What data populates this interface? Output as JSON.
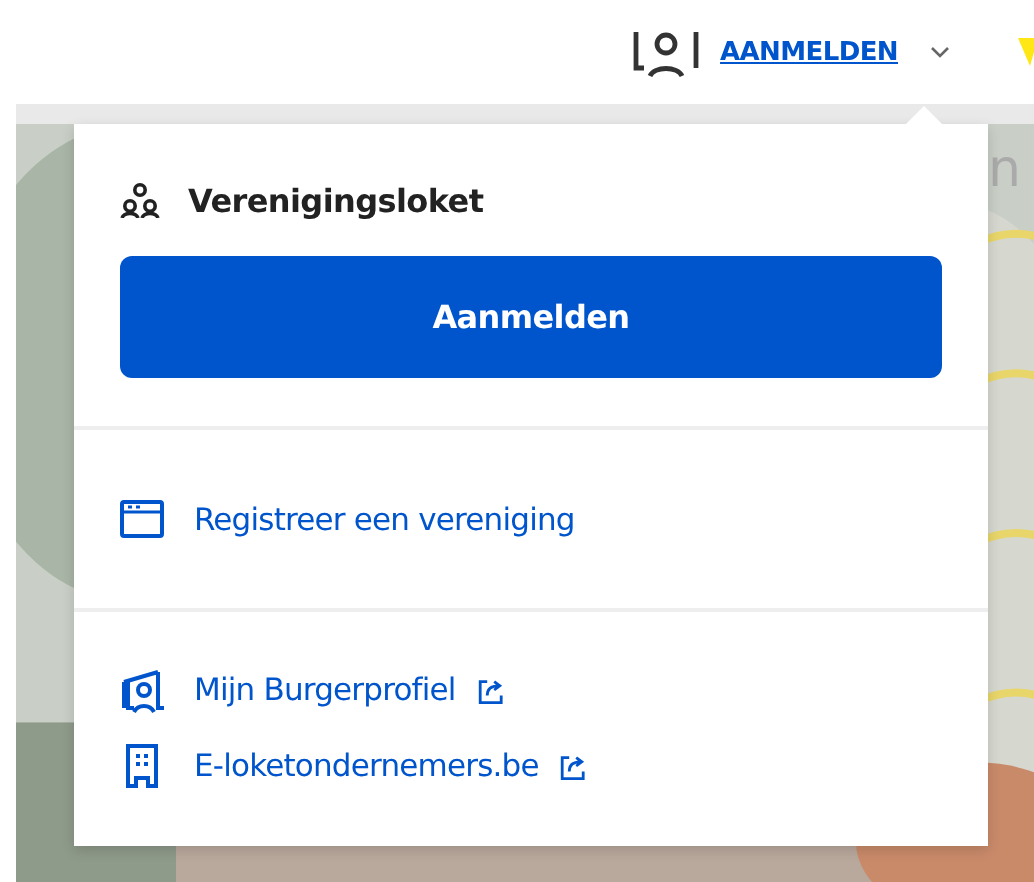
{
  "header": {
    "login_link": "AANMELDEN",
    "menu_expanded": true
  },
  "background_text": "n",
  "dropdown": {
    "title": "Verenigingsloket",
    "button": "Aanmelden",
    "sections": [
      {
        "links": [
          {
            "label": "Registreer een vereniging",
            "kind": "window",
            "external": false
          }
        ]
      },
      {
        "links": [
          {
            "label": "Mijn Burgerprofiel",
            "kind": "profile",
            "external": true
          },
          {
            "label": "E-loketondernemers.be",
            "kind": "building",
            "external": true
          }
        ]
      }
    ]
  }
}
